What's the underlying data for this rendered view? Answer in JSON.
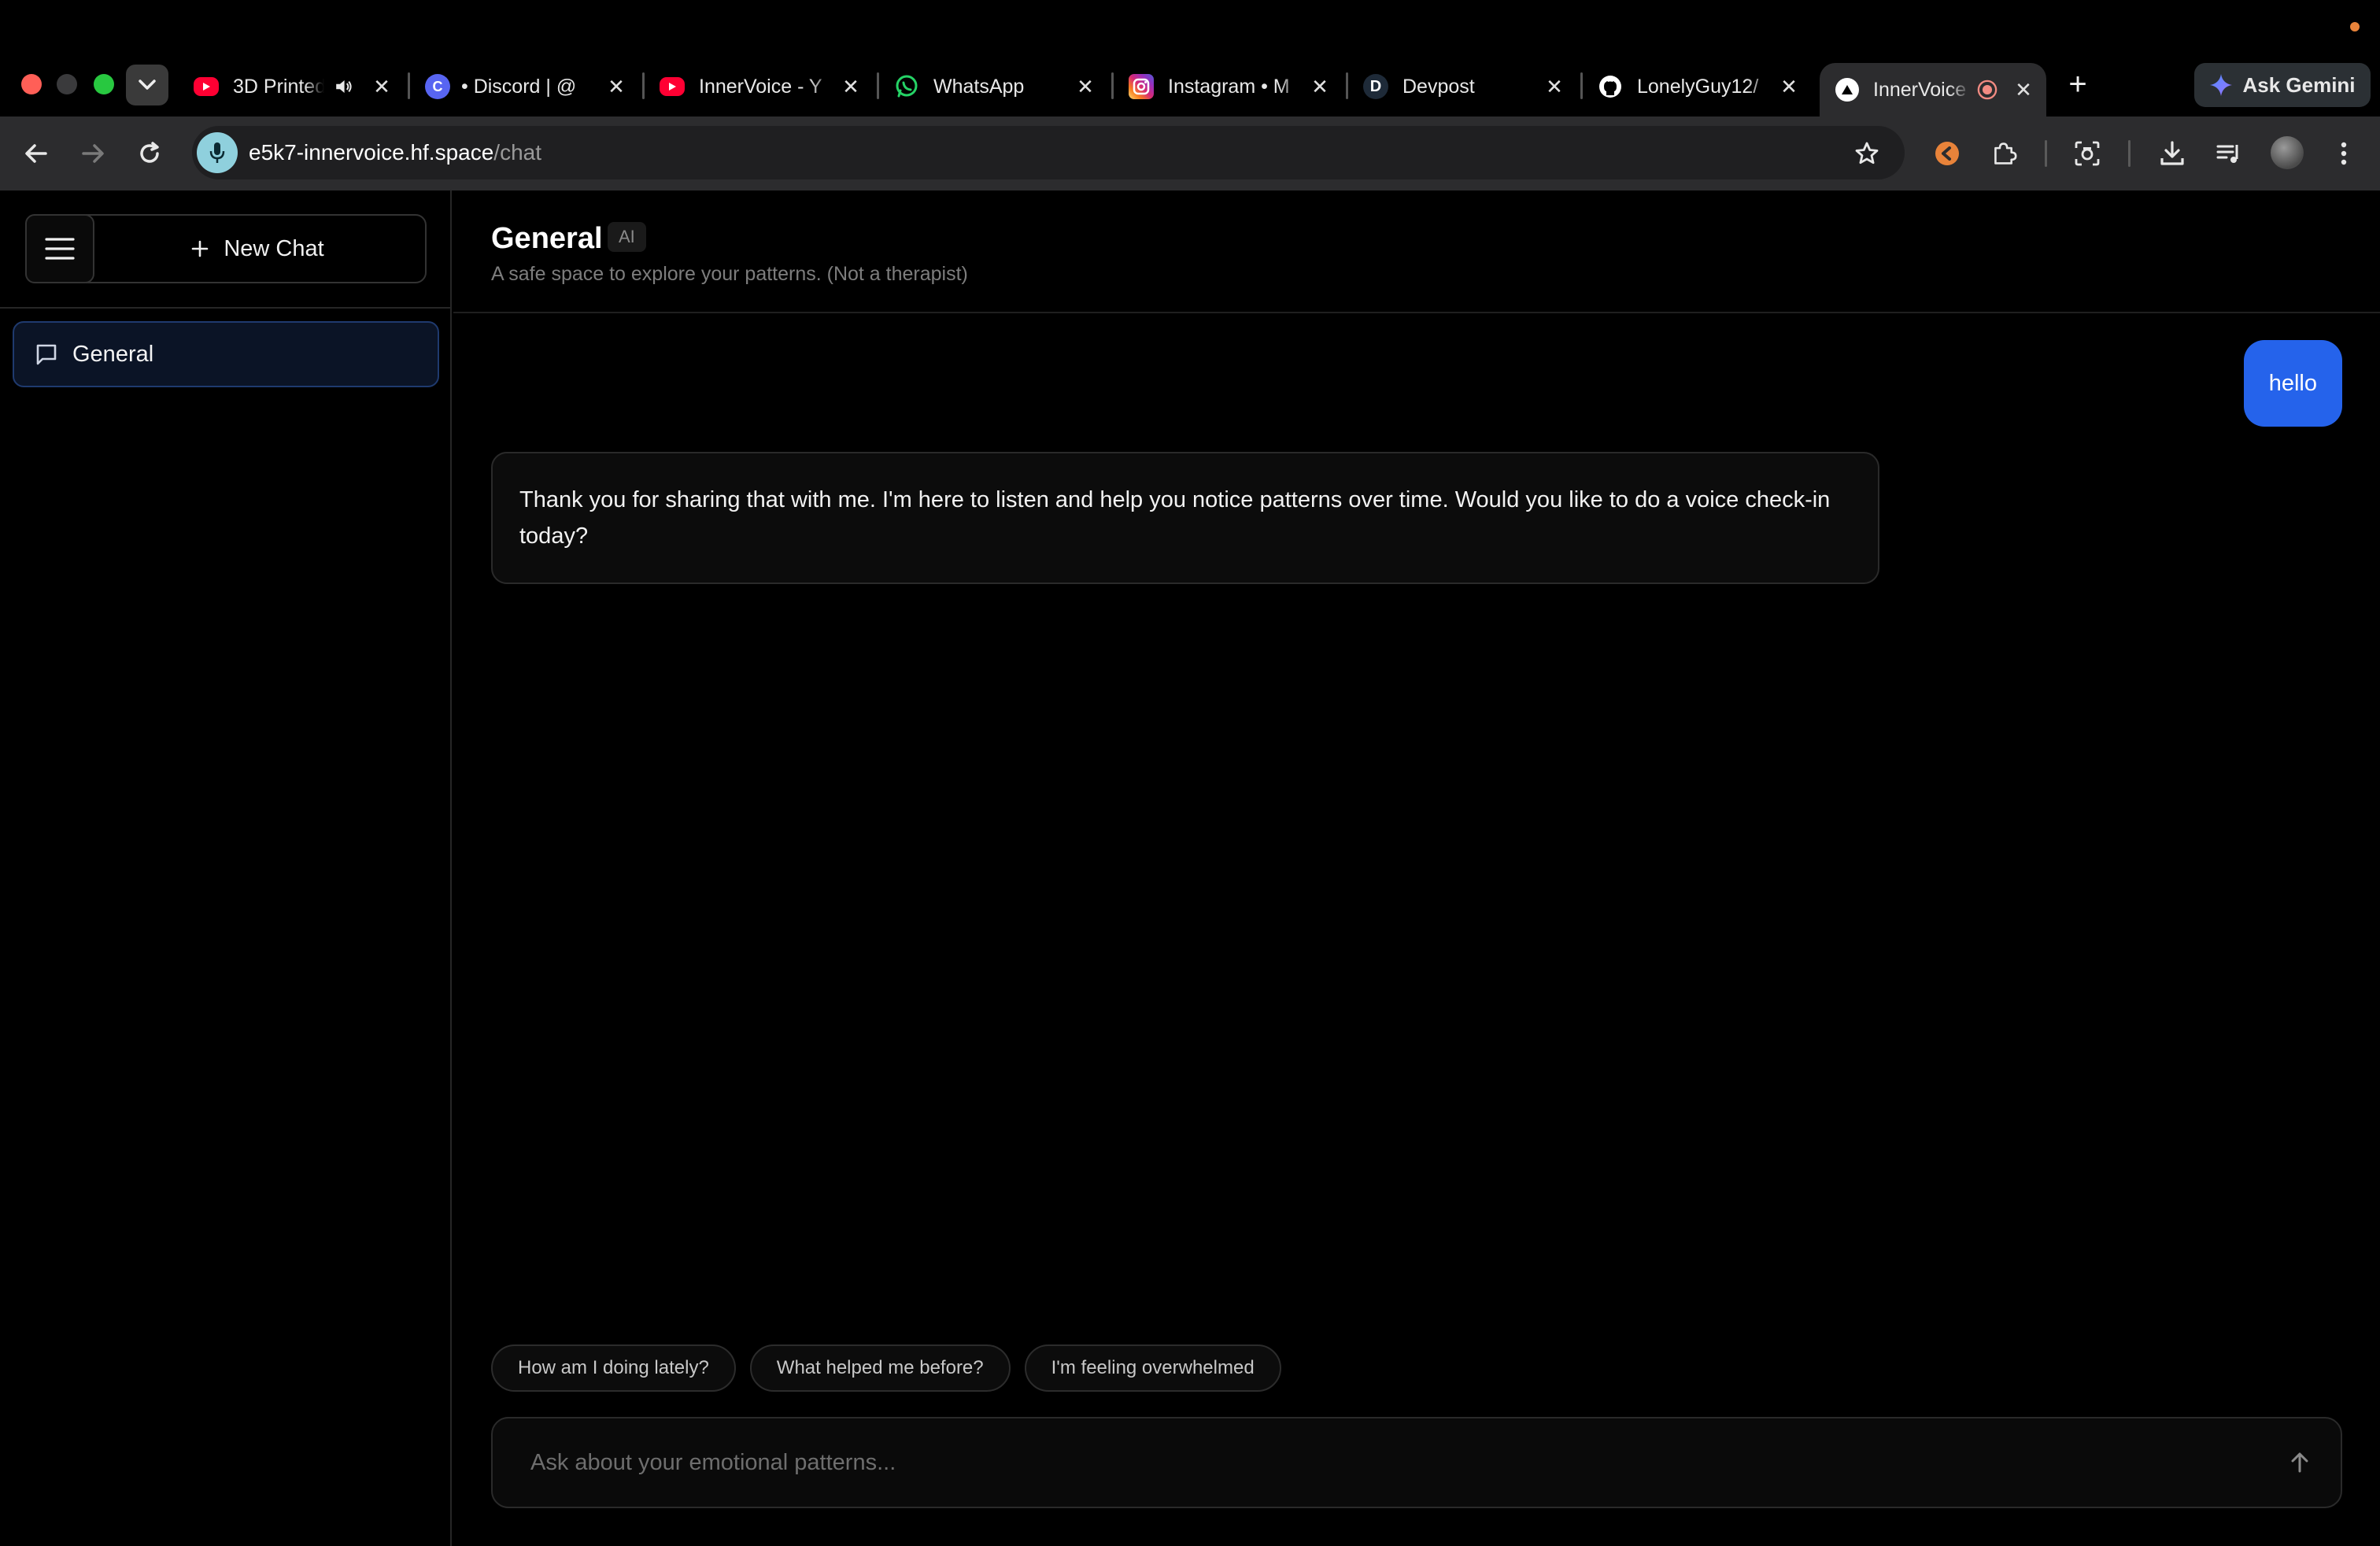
{
  "browser": {
    "tabs": [
      {
        "title": "3D Printed",
        "favicon": "youtube-icon",
        "color": "#ff0033"
      },
      {
        "title": "• Discord | @",
        "favicon": "discord-icon",
        "color": "#5865f2"
      },
      {
        "title": "InnerVoice - Y",
        "favicon": "youtube-icon",
        "color": "#ff0033"
      },
      {
        "title": "WhatsApp",
        "favicon": "whatsapp-icon",
        "color": "#25d366"
      },
      {
        "title": "Instagram • M",
        "favicon": "instagram-icon",
        "color": "#e1306c"
      },
      {
        "title": "Devpost",
        "favicon": "devpost-icon",
        "color": "#1e2a38"
      },
      {
        "title": "LonelyGuy12/",
        "favicon": "github-icon",
        "color": "#ffffff"
      },
      {
        "title": "InnerVoice",
        "favicon": "innervoice-icon",
        "color": "#ffffff",
        "active": true
      }
    ],
    "discord_letter": "C",
    "devpost_letter": "D",
    "new_tab_symbol": "+",
    "gemini_label": "Ask Gemini",
    "url_host": "e5k7-innervoice.hf.space",
    "url_path": "/chat"
  },
  "sidebar": {
    "new_chat_label": "New Chat",
    "chats": [
      {
        "label": "General",
        "active": true
      }
    ]
  },
  "header": {
    "title": "General",
    "badge": "AI",
    "subtitle": "A safe space to explore your patterns. (Not a therapist)"
  },
  "messages": {
    "user": "hello",
    "assistant": "Thank you for sharing that with me. I'm here to listen and help you notice patterns over time. Would you like to do a voice check-in today?"
  },
  "suggestions": [
    "How am I doing lately?",
    "What helped me before?",
    "I'm feeling overwhelmed"
  ],
  "composer": {
    "placeholder": "Ask about your emotional patterns..."
  },
  "colors": {
    "accent": "#2563eb",
    "background": "#000000"
  }
}
